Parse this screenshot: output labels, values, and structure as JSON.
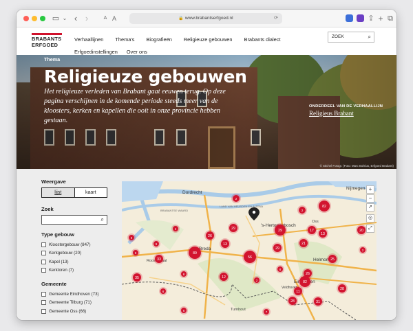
{
  "browser": {
    "url": "www.brabantserfgoed.nl"
  },
  "site": {
    "logo_line1": "BRABANTS",
    "logo_line2": "ERFGOED",
    "nav": [
      "Verhaallijnen",
      "Thema's",
      "Biografieën",
      "Religieuze gebouwen",
      "Brabants dialect",
      "Erfgoedinstellingen",
      "Over ons"
    ],
    "search_placeholder": "ZOEK"
  },
  "hero": {
    "label": "Thema",
    "title": "Religieuze gebouwen",
    "intro": "Het religieuze verleden van Brabant gaat eeuwen terug. Op deze pagina verschijnen in de komende periode steeds meer van de kloosters, kerken en kapellen die ooit in onze provincie hebben gestaan.",
    "part_of_label": "ONDERDEEL VAN DE VERHAALLIJN",
    "part_of_link": "Religieus Brabant",
    "credit": "© Stichel Fotogr. (Foto: Marc Bolsius, Erfgoed Brabant)"
  },
  "filters": {
    "weergave_title": "Weergave",
    "view_options": [
      "lijst",
      "kaart"
    ],
    "zoek_title": "Zoek",
    "type_title": "Type gebouw",
    "types": [
      "Kloostergebouw (847)",
      "Kerkgebouw (20)",
      "Kapel (13)",
      "Kerktoren (7)"
    ],
    "gemeente_title": "Gemeente",
    "gemeenten": [
      "Gemeente Eindhoven (73)",
      "Gemeente Tilburg (71)",
      "Gemeente Oss (66)"
    ]
  },
  "map": {
    "places": [
      "Dordrecht",
      "Nijmegen",
      "'s-Hertogenbosch",
      "Breda",
      "Roosendaal",
      "Helmond",
      "Eindhoven",
      "Turnhout",
      "Oss",
      "Veldhoven",
      "LAND VAN HEUSDEN EN ALTENA",
      "BRABANTSE WAARD"
    ],
    "zoom_in": "+",
    "zoom_out": "−",
    "clusters": [
      {
        "n": "2"
      },
      {
        "n": "82"
      },
      {
        "n": "2"
      },
      {
        "n": "29"
      },
      {
        "n": "29"
      },
      {
        "n": "17"
      },
      {
        "n": "13"
      },
      {
        "n": "20"
      },
      {
        "n": "26"
      },
      {
        "n": "13"
      },
      {
        "n": "89"
      },
      {
        "n": "33"
      },
      {
        "n": "56"
      },
      {
        "n": "29"
      },
      {
        "n": "21"
      },
      {
        "n": "25"
      },
      {
        "n": "9"
      },
      {
        "n": "2"
      },
      {
        "n": "35"
      },
      {
        "n": "12"
      },
      {
        "n": "8"
      },
      {
        "n": "8"
      },
      {
        "n": "82"
      },
      {
        "n": "28"
      },
      {
        "n": "11"
      },
      {
        "n": "28"
      },
      {
        "n": "31"
      },
      {
        "n": "26"
      },
      {
        "n": "2"
      },
      {
        "n": "6"
      },
      {
        "n": "6"
      },
      {
        "n": "9"
      },
      {
        "n": "9"
      },
      {
        "n": "2"
      },
      {
        "n": "7"
      }
    ]
  }
}
